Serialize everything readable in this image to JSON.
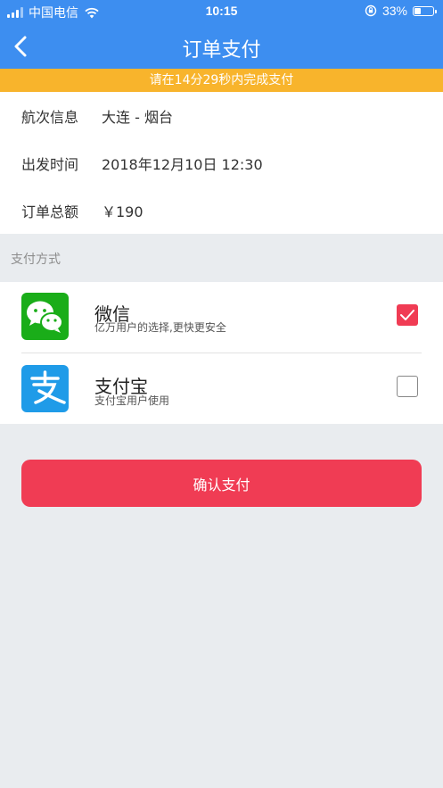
{
  "status_bar": {
    "carrier": "中国电信",
    "time": "10:15",
    "battery_percent": "33%",
    "battery_level": 0.33
  },
  "nav": {
    "title": "订单支付",
    "back_icon": "chevron-left-icon"
  },
  "timer": {
    "text": "请在14分29秒内完成支付"
  },
  "order": {
    "rows": [
      {
        "label": "航次信息",
        "value": "大连 - 烟台"
      },
      {
        "label": "出发时间",
        "value": "2018年12月10日 12:30"
      },
      {
        "label": "订单总额",
        "value": "￥190"
      }
    ]
  },
  "payment": {
    "section_title": "支付方式",
    "methods": [
      {
        "name": "微信",
        "desc": "亿万用户的选择,更快更安全",
        "selected": true,
        "icon": "wechat-icon",
        "color": "#1aad19"
      },
      {
        "name": "支付宝",
        "desc": "支付宝用户使用",
        "selected": false,
        "icon": "alipay-icon",
        "color": "#1f9be8"
      }
    ]
  },
  "confirm": {
    "label": "确认支付"
  },
  "colors": {
    "primary": "#3d8ef0",
    "timer": "#f8b42c",
    "confirm": "#f03c54"
  }
}
